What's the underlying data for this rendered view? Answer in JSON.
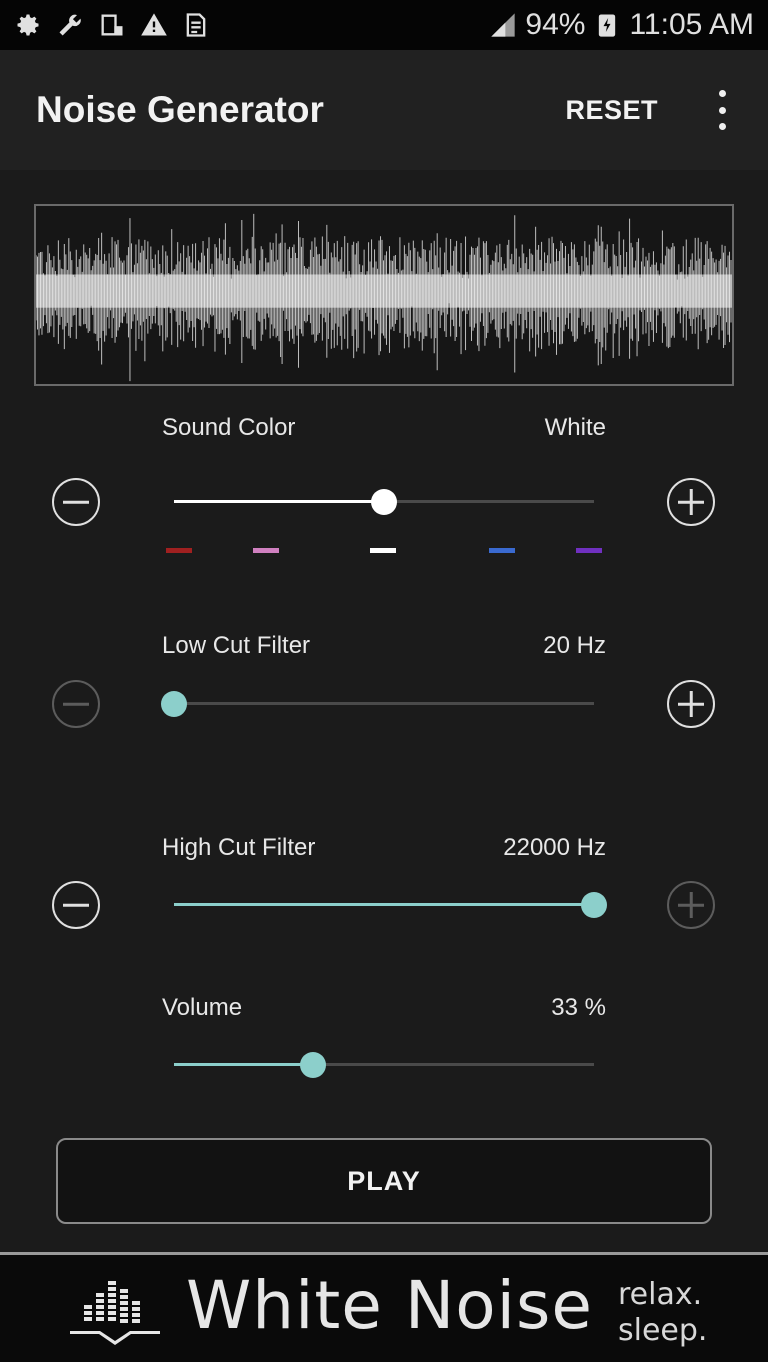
{
  "status_bar": {
    "battery": "94%",
    "time": "11:05 AM",
    "left_icons": [
      "gear-icon",
      "wrench-icon",
      "device-icon",
      "warning-icon",
      "document-icon"
    ],
    "right_icons": [
      "signal-icon",
      "battery-saver-icon"
    ]
  },
  "app_bar": {
    "title": "Noise Generator",
    "reset_label": "RESET",
    "menu_icon": "more-vert-icon"
  },
  "controls": {
    "sound_color": {
      "label": "Sound Color",
      "value": "White",
      "position": 0.5,
      "color_marks": [
        "#a02020",
        "#d080c0",
        "#ffffff",
        "#3a6ad0",
        "#7030c0"
      ]
    },
    "low_cut": {
      "label": "Low Cut Filter",
      "value": "20 Hz",
      "position": 0.0
    },
    "high_cut": {
      "label": "High Cut Filter",
      "value": "22000 Hz",
      "position": 1.0
    },
    "volume": {
      "label": "Volume",
      "value": "33 %",
      "position": 0.33
    }
  },
  "play_label": "PLAY",
  "ad": {
    "title": "White Noise",
    "tagline_1": "relax.",
    "tagline_2": "sleep."
  },
  "colors": {
    "accent": "#8ccfcb",
    "thumb_white": "#ffffff",
    "background": "#1b1b1b"
  }
}
